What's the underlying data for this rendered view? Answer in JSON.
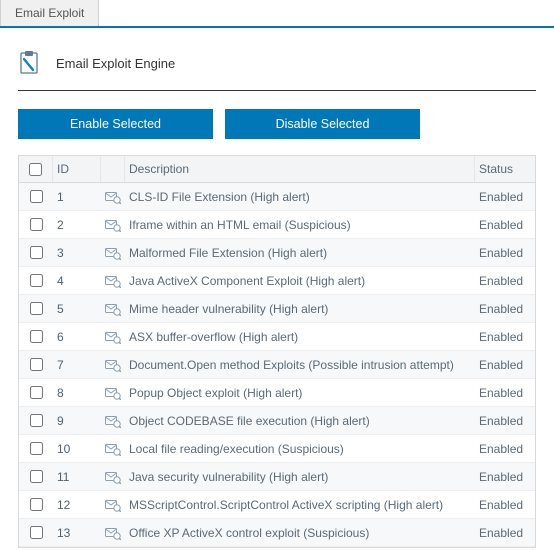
{
  "tab": {
    "label": "Email Exploit"
  },
  "header": {
    "title": "Email Exploit Engine"
  },
  "buttons": {
    "enable": "Enable Selected",
    "disable": "Disable Selected"
  },
  "columns": {
    "id": "ID",
    "description": "Description",
    "status": "Status"
  },
  "rows": [
    {
      "id": "1",
      "desc": "CLS-ID File Extension (High alert)",
      "status": "Enabled"
    },
    {
      "id": "2",
      "desc": "Iframe within an HTML email (Suspicious)",
      "status": "Enabled"
    },
    {
      "id": "3",
      "desc": "Malformed File Extension (High alert)",
      "status": "Enabled"
    },
    {
      "id": "4",
      "desc": "Java ActiveX Component Exploit (High alert)",
      "status": "Enabled"
    },
    {
      "id": "5",
      "desc": "Mime header vulnerability (High alert)",
      "status": "Enabled"
    },
    {
      "id": "6",
      "desc": "ASX buffer-overflow (High alert)",
      "status": "Enabled"
    },
    {
      "id": "7",
      "desc": "Document.Open method Exploits (Possible intrusion attempt)",
      "status": "Enabled"
    },
    {
      "id": "8",
      "desc": "Popup Object exploit (High alert)",
      "status": "Enabled"
    },
    {
      "id": "9",
      "desc": "Object CODEBASE file execution (High alert)",
      "status": "Enabled"
    },
    {
      "id": "10",
      "desc": "Local file reading/execution (Suspicious)",
      "status": "Enabled"
    },
    {
      "id": "11",
      "desc": "Java security vulnerability (High alert)",
      "status": "Enabled"
    },
    {
      "id": "12",
      "desc": "MSScriptControl.ScriptControl ActiveX scripting (High alert)",
      "status": "Enabled"
    },
    {
      "id": "13",
      "desc": "Office XP ActiveX control exploit (Suspicious)",
      "status": "Enabled"
    }
  ],
  "colors": {
    "accent": "#0078b7"
  }
}
